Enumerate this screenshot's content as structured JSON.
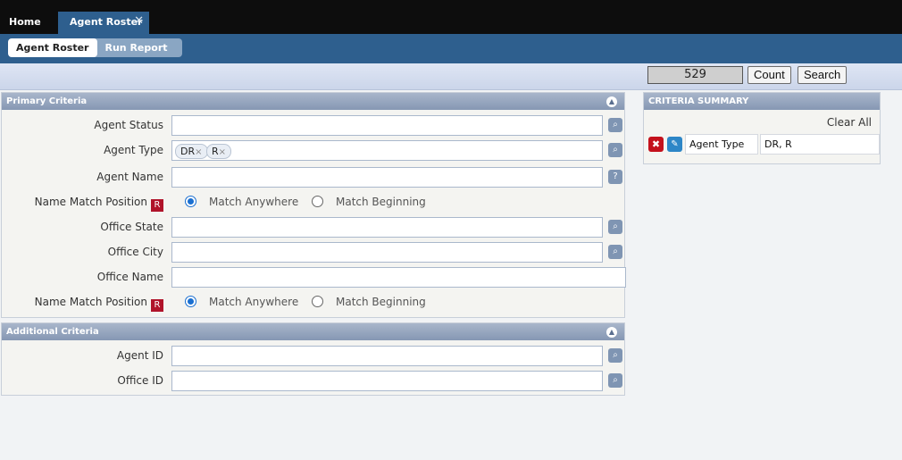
{
  "tabs": {
    "home": "Home",
    "agent_roster": "Agent Roster",
    "close_glyph": "✕"
  },
  "subnav": {
    "active": "Agent Roster",
    "run_report": "Run Report"
  },
  "toolbar": {
    "count_value": "529",
    "count_label": "Count",
    "search_label": "Search"
  },
  "primary": {
    "title": "Primary Criteria",
    "agent_status": "Agent Status",
    "agent_type": "Agent Type",
    "agent_type_chips": [
      "DR",
      "R"
    ],
    "agent_name": "Agent Name",
    "name_match_position": "Name Match Position",
    "required_badge": "R",
    "match_anywhere": "Match Anywhere",
    "match_beginning": "Match Beginning",
    "office_state": "Office State",
    "office_city": "Office City",
    "office_name": "Office Name",
    "help_glyph": "?"
  },
  "additional": {
    "title": "Additional Criteria",
    "agent_id": "Agent ID",
    "office_id": "Office ID"
  },
  "summary": {
    "title": "CRITERIA SUMMARY",
    "clear_all": "Clear All",
    "rows": [
      {
        "key": "Agent Type",
        "value": "DR, R"
      }
    ]
  },
  "icons": {
    "collapse": "chevron-up-icon",
    "lookup": "magnifier-icon",
    "delete": "delete-icon",
    "edit": "pencil-icon"
  },
  "colors": {
    "nav_blue": "#2e5f8e",
    "required_red": "#b0132a",
    "radio_blue": "#1a6fd0"
  }
}
